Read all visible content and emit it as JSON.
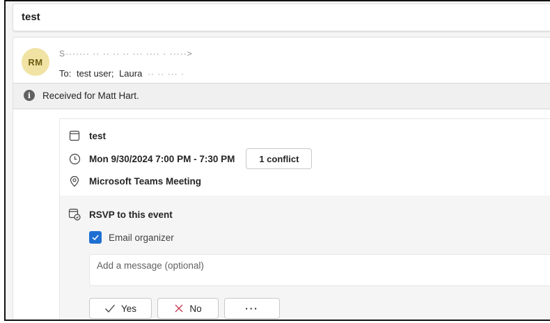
{
  "subject": "test",
  "sender": {
    "initials": "RM",
    "from_redacted": "S······· ·· ·· ·· ·· ··· ···· · ·····>",
    "to_label": "To:",
    "to_recipients": [
      "test user;",
      "Laura"
    ],
    "to_redacted": "·· ·· ··· ·"
  },
  "info_bar": {
    "text": "Received for Matt Hart."
  },
  "event": {
    "title": "test",
    "datetime": "Mon 9/30/2024 7:00 PM - 7:30 PM",
    "conflict_label": "1 conflict",
    "location": "Microsoft Teams Meeting"
  },
  "rsvp": {
    "title": "RSVP to this event",
    "email_organizer_label": "Email organizer",
    "email_organizer_checked": true,
    "message_placeholder": "Add a message (optional)",
    "yes_label": "Yes",
    "no_label": "No",
    "more_label": "···"
  },
  "colors": {
    "avatar_bg": "#f1e3a3",
    "checkbox_accent": "#1f6fd1",
    "no_icon": "#c4314b"
  }
}
